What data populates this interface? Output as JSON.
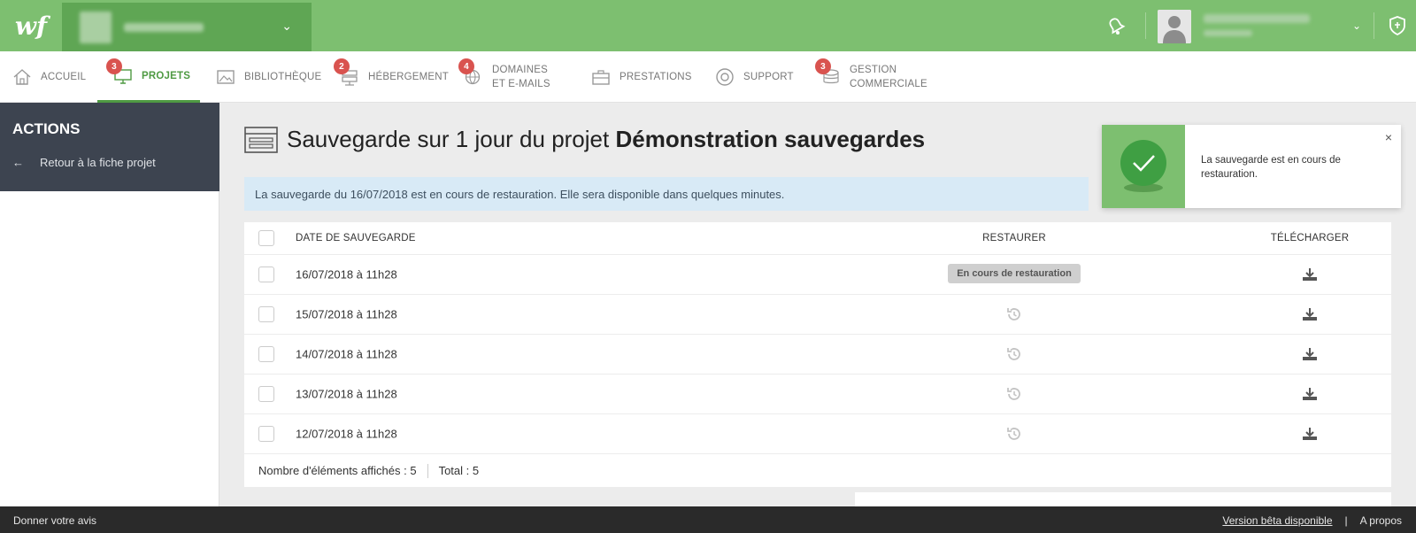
{
  "brand": {
    "logo_text": "wf",
    "accent": "#7dbf70",
    "accent_dark": "#4f9a43"
  },
  "nav": {
    "items": [
      {
        "label": "Accueil",
        "icon": "home-icon"
      },
      {
        "label": "Projets",
        "icon": "monitor-icon",
        "badge": "3",
        "active": true
      },
      {
        "label": "Bibliothèque",
        "icon": "image-icon"
      },
      {
        "label": "Hébergement",
        "icon": "server-icon",
        "badge": "2"
      },
      {
        "label_line1": "Domaines",
        "label_line2": "et e-mails",
        "icon": "globe-icon",
        "badge": "4"
      },
      {
        "label": "Prestations",
        "icon": "briefcase-icon"
      },
      {
        "label": "Support",
        "icon": "lifebuoy-icon"
      },
      {
        "label_line1": "Gestion",
        "label_line2": "commerciale",
        "icon": "coins-icon",
        "badge": "3"
      }
    ]
  },
  "sidebar": {
    "title": "ACTIONS",
    "back_label": "Retour à la fiche projet"
  },
  "page": {
    "title_prefix": "Sauvegarde sur 1 jour du projet",
    "title_project": "Démonstration sauvegardes",
    "info_message": "La sauvegarde du 16/07/2018 est en cours de restauration. Elle sera disponible dans quelques minutes."
  },
  "table": {
    "headers": {
      "date": "DATE DE SAUVEGARDE",
      "restore": "RESTAURER",
      "download": "TÉLÉCHARGER"
    },
    "rows": [
      {
        "date": "16/07/2018 à 11h28",
        "restore_status": "En cours de restauration"
      },
      {
        "date": "15/07/2018 à 11h28"
      },
      {
        "date": "14/07/2018 à 11h28"
      },
      {
        "date": "13/07/2018 à 11h28"
      },
      {
        "date": "12/07/2018 à 11h28"
      }
    ],
    "footer": {
      "shown": "Nombre d'éléments affichés : 5",
      "total": "Total : 5"
    }
  },
  "toast": {
    "message": "La sauvegarde est en cours de restauration.",
    "close": "×"
  },
  "bottombar": {
    "feedback": "Donner votre avis",
    "beta": "Version bêta disponible",
    "separator": "|",
    "about": "A propos"
  }
}
